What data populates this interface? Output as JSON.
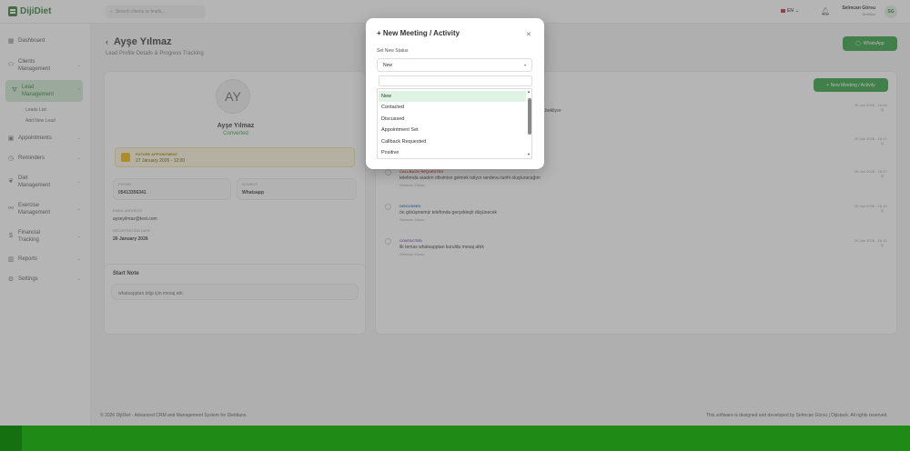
{
  "brand": {
    "name": "DijiDiet"
  },
  "topbar": {
    "search_placeholder": "Search clients or leads...",
    "lang": "EN",
    "user_name": "Selmcan Görsu",
    "user_role": "Dietitian",
    "avatar": "SG"
  },
  "sidebar": {
    "items": [
      {
        "label": "Dashboard",
        "icon": "grid-icon"
      },
      {
        "label": "Clients Management",
        "icon": "users-icon"
      },
      {
        "label": "Lead Management",
        "icon": "funnel-icon"
      },
      {
        "label": "Leads List"
      },
      {
        "label": "Add New Lead"
      },
      {
        "label": "Appointments",
        "icon": "calendar-icon"
      },
      {
        "label": "Reminders",
        "icon": "clock-icon"
      },
      {
        "label": "Diet Management",
        "icon": "leaf-icon"
      },
      {
        "label": "Exercise Management",
        "icon": "dumbbell-icon"
      },
      {
        "label": "Financial Tracking",
        "icon": "dollar-icon"
      },
      {
        "label": "Reports",
        "icon": "chart-icon"
      },
      {
        "label": "Settings",
        "icon": "gear-icon"
      }
    ]
  },
  "page": {
    "title": "Ayşe Yılmaz",
    "subtitle": "Lead Profile Details & Progress Tracking",
    "whatsapp": "WhatsApp"
  },
  "profile": {
    "initials": "AY",
    "name": "Ayşe Yılmaz",
    "status": "Converted",
    "appointment_label": "FUTURE APPOINTMENT",
    "appointment_date": "27 January 2026 - 12:00",
    "phone_label": "PHONE",
    "phone": "05413356341",
    "source_label": "SOURCE",
    "source": "Whatsapp",
    "email_label": "EMAIL ADDRESS",
    "email": "ayseyilmaz@test.com",
    "reg_label": "REGISTRATION DATE",
    "reg_date": "26 January 2026"
  },
  "note": {
    "title": "Start Note",
    "text": "whatsapptan bilgi için mesaj attı."
  },
  "activity": {
    "new_button": "+ New Meeting / Activity",
    "items": [
      {
        "type": "",
        "text": "...bekliyor",
        "user": "",
        "date": "26 Jan 2026 - 16:18"
      },
      {
        "type": "",
        "text": "",
        "user": "",
        "date": "26 Jan 2026 - 16:17"
      },
      {
        "type": "CALLBACK REQUESTED",
        "text": "telefonda aradım ofisimize gelmek istiyor randevu tarihi oluşturacağım",
        "user": "Selmcan Görsu",
        "date": "26 Jan 2026 - 16:17"
      },
      {
        "type": "DISCUSSED",
        "text": "ön görüşmemiz telefonda gerçekleşti düşünecek",
        "user": "Selmcan Görsu",
        "date": "26 Jan 2026 - 16:16"
      },
      {
        "type": "CONTACTED",
        "text": "ilk temas whatsapptan kuruldu mesaj attık",
        "user": "Selmcan Görsu",
        "date": "26 Jan 2026 - 16:15"
      }
    ]
  },
  "modal": {
    "title": "+ New Meeting / Activity",
    "status_label": "Set New Status",
    "selected": "New",
    "options": [
      "New",
      "Contacted",
      "Discussed",
      "Appointment Set",
      "Callback Requested",
      "Positive"
    ]
  },
  "footer": {
    "left": "© 2026 DijiDiet - Advanced CRM and Management System for Dietitians.",
    "right": "This software is designed and developed by Selmcan Görsu | Dijistack. All rights reserved."
  }
}
